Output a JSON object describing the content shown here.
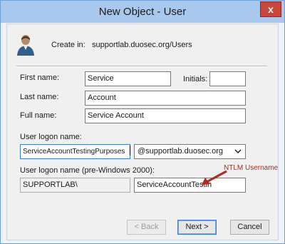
{
  "window": {
    "title": "New Object - User",
    "close_glyph": "x"
  },
  "header": {
    "icon": "user-icon",
    "create_in_label": "Create in:",
    "create_in_path": "supportlab.duosec.org/Users"
  },
  "form": {
    "first_name_label": "First name:",
    "first_name_value": "Service",
    "initials_label": "Initials:",
    "initials_value": "",
    "last_name_label": "Last name:",
    "last_name_value": "Account",
    "full_name_label": "Full name:",
    "full_name_value": "Service Account",
    "logon_name_label": "User logon name:",
    "logon_name_value": "ServiceAccountTestingPurposes",
    "domain_value": "@supportlab.duosec.org",
    "pre2000_label": "User logon name (pre-Windows 2000):",
    "pre2000_domain_value": "SUPPORTLAB\\",
    "pre2000_name_value": "ServiceAccountTestin"
  },
  "annotation": {
    "text": "NTLM Username",
    "color": "#b02a22"
  },
  "buttons": {
    "back": "< Back",
    "next": "Next >",
    "cancel": "Cancel"
  }
}
